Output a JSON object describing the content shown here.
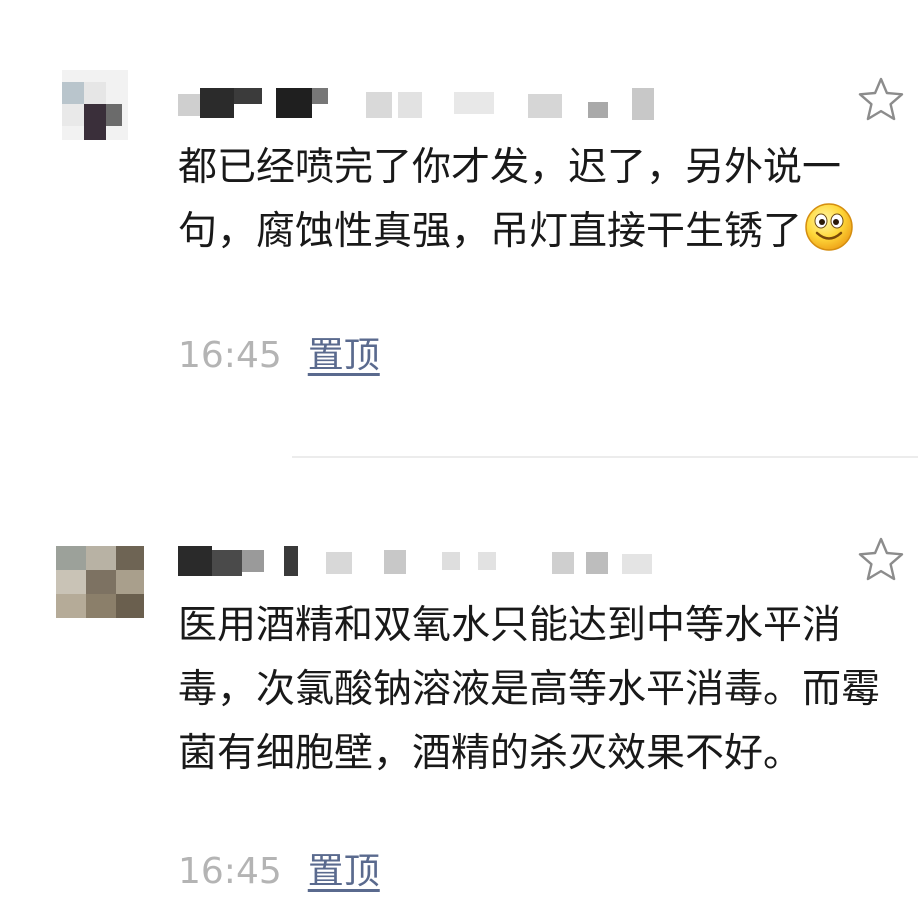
{
  "comments": [
    {
      "text": "都已经喷完了你才发，迟了，另外说一句，腐蚀性真强，吊灯直接干生锈了",
      "emoji": "smiley-face-icon",
      "time": "16:45",
      "pin_label": "置顶"
    },
    {
      "text": "医用酒精和双氧水只能达到中等水平消毒，次氯酸钠溶液是高等水平消毒。而霉菌有细胞壁，酒精的杀灭效果不好。",
      "time": "16:45",
      "pin_label": "置顶"
    }
  ],
  "colors": {
    "text": "#191919",
    "time": "#b4b4b4",
    "pin_link": "#5a6a8e",
    "divider": "#ececec",
    "star_outline": "#8c8c8c"
  }
}
